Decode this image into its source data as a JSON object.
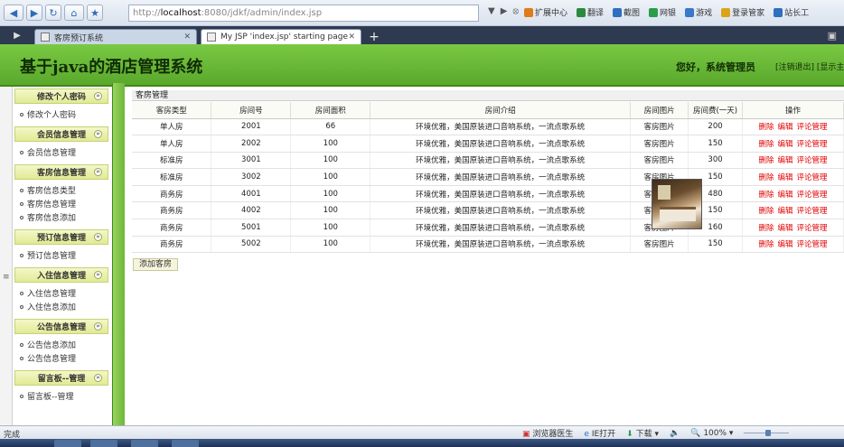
{
  "browser": {
    "url_prefix": "http://",
    "url_host": "localhost",
    "url_rest": ":8080/jdkf/admin/index.jsp",
    "toolbar": [
      "扩展中心",
      "翻译",
      "截图",
      "网银",
      "游戏",
      "登录管家",
      "站长工"
    ],
    "tabs": [
      {
        "title": "客房预订系统",
        "active": false
      },
      {
        "title": "My JSP 'index.jsp' starting page",
        "active": true
      }
    ]
  },
  "header": {
    "title": "基于java的酒店管理系统",
    "greeting": "您好，系统管理员",
    "links": "[注销退出] [显示主页]"
  },
  "sidebar": [
    {
      "title": "修改个人密码",
      "items": [
        "修改个人密码"
      ]
    },
    {
      "title": "会员信息管理",
      "items": [
        "会员信息管理"
      ]
    },
    {
      "title": "客房信息管理",
      "items": [
        "客房信息类型",
        "客房信息管理",
        "客房信息添加"
      ]
    },
    {
      "title": "预订信息管理",
      "items": [
        "预订信息管理"
      ]
    },
    {
      "title": "入住信息管理",
      "items": [
        "入住信息管理",
        "入住信息添加"
      ]
    },
    {
      "title": "公告信息管理",
      "items": [
        "公告信息添加",
        "公告信息管理"
      ]
    },
    {
      "title": "留言板--管理",
      "items": [
        "留言板--管理"
      ]
    }
  ],
  "main": {
    "caption": "客房管理",
    "columns": [
      "客房类型",
      "房间号",
      "房间面积",
      "房间介绍",
      "房间图片",
      "房间费(一天)",
      "操作"
    ],
    "rows": [
      [
        "单人房",
        "2001",
        "66",
        "环境优雅，美国原装进口音响系统，一流点歌系统",
        "客房图片",
        "200"
      ],
      [
        "单人房",
        "2002",
        "100",
        "环境优雅，美国原装进口音响系统，一流点歌系统",
        "客房图片",
        "150"
      ],
      [
        "标准房",
        "3001",
        "100",
        "环境优雅，美国原装进口音响系统，一流点歌系统",
        "客房图片",
        "300"
      ],
      [
        "标准房",
        "3002",
        "100",
        "环境优雅，美国原装进口音响系统，一流点歌系统",
        "客房图片",
        "150"
      ],
      [
        "商务房",
        "4001",
        "100",
        "环境优雅，美国原装进口音响系统，一流点歌系统",
        "客房图片",
        "480"
      ],
      [
        "商务房",
        "4002",
        "100",
        "环境优雅，美国原装进口音响系统，一流点歌系统",
        "客房图片",
        "150"
      ],
      [
        "商务房",
        "5001",
        "100",
        "环境优雅，美国原装进口音响系统，一流点歌系统",
        "客房图片",
        "160"
      ],
      [
        "商务房",
        "5002",
        "100",
        "环境优雅，美国原装进口音响系统，一流点歌系统",
        "客房图片",
        "150"
      ]
    ],
    "actions": [
      "删除",
      "编辑",
      "评论管理"
    ],
    "add_button": "添加客房"
  },
  "status": {
    "left": "完成",
    "items": [
      "浏览器医生",
      "IE打开",
      "下载",
      "100%"
    ]
  },
  "colors": {
    "header_green": "#6bbb38",
    "action_red": "#e00000"
  }
}
